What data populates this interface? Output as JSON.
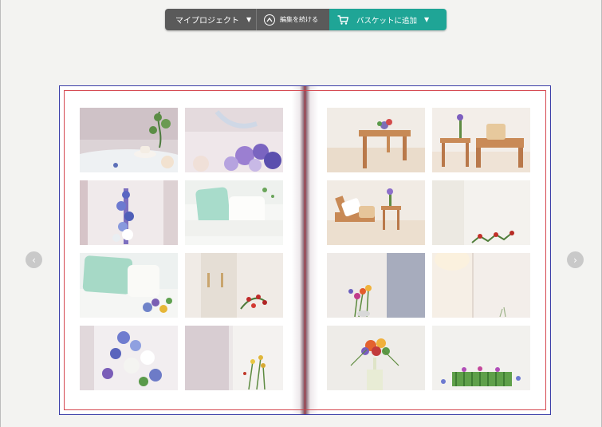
{
  "toolbar": {
    "project_label": "マイプロジェクト",
    "edit_label": "編集を続ける",
    "basket_label": "バスケットに追加",
    "caret": "▼"
  },
  "nav": {
    "prev_glyph": "‹",
    "next_glyph": "›"
  },
  "colors": {
    "toolbar_dark": "#5a5a5a",
    "toolbar_accent": "#1fa596",
    "album_border": "#3b3ea8",
    "bleed_line": "#d5474f"
  },
  "album": {
    "left_page": [
      {
        "icon": "tea-table-flower-photo"
      },
      {
        "icon": "purple-flowers-photo"
      },
      {
        "icon": "blue-flower-vase-photo"
      },
      {
        "icon": "mint-cushion-sofa-photo"
      },
      {
        "icon": "cushion-flowers-photo"
      },
      {
        "icon": "door-red-berries-photo"
      },
      {
        "icon": "blue-white-bouquet-photo"
      },
      {
        "icon": "window-flowers-photo"
      }
    ],
    "right_page": [
      {
        "icon": "wooden-table-photo"
      },
      {
        "icon": "chair-side-table-photo"
      },
      {
        "icon": "armchair-flower-photo"
      },
      {
        "icon": "curtain-red-flower-photo"
      },
      {
        "icon": "wall-bouquet-photo"
      },
      {
        "icon": "corner-light-photo"
      },
      {
        "icon": "flower-stand-photo"
      },
      {
        "icon": "green-stems-photo"
      }
    ]
  }
}
